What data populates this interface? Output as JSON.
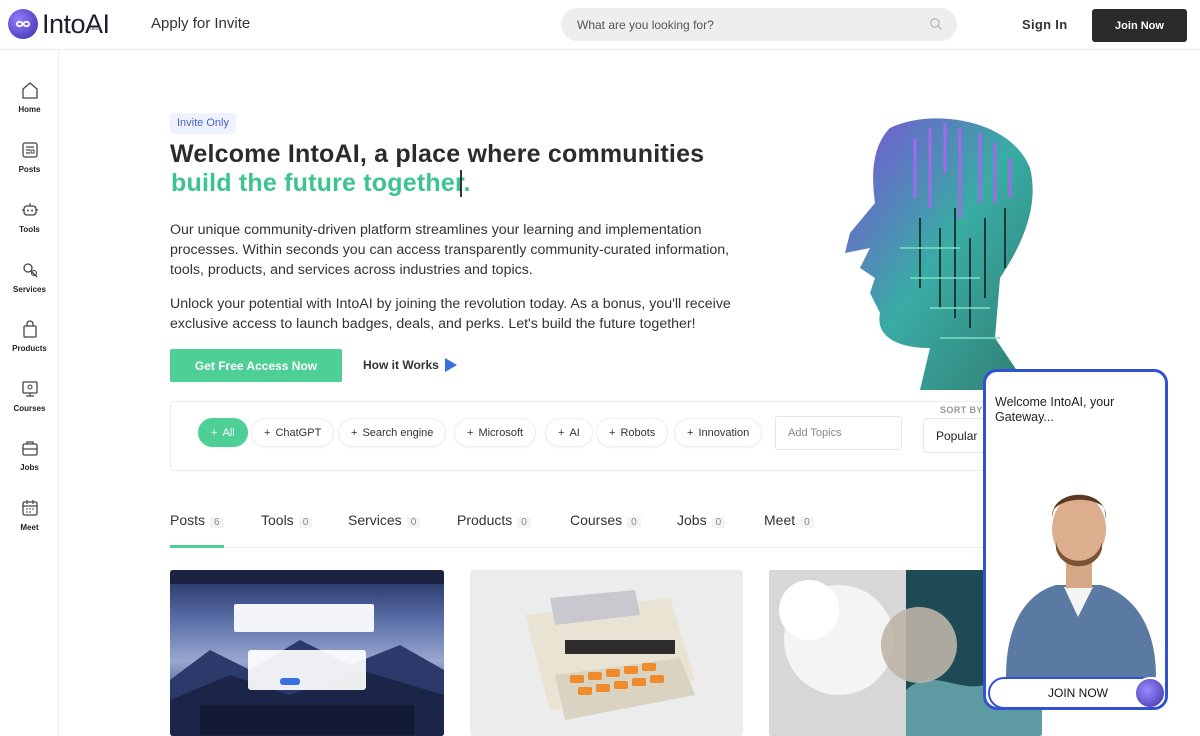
{
  "header": {
    "logo_text": "IntoAI",
    "logo_beta": "beta",
    "apply": "Apply for Invite",
    "search_placeholder": "What are you looking for?",
    "signin": "Sign In",
    "join": "Join Now"
  },
  "sidebar": {
    "items": [
      {
        "label": "Home",
        "icon": "home-icon"
      },
      {
        "label": "Posts",
        "icon": "posts-icon"
      },
      {
        "label": "Tools",
        "icon": "robot-icon"
      },
      {
        "label": "Services",
        "icon": "services-icon"
      },
      {
        "label": "Products",
        "icon": "bag-icon"
      },
      {
        "label": "Courses",
        "icon": "courses-icon"
      },
      {
        "label": "Jobs",
        "icon": "briefcase-icon"
      },
      {
        "label": "Meet",
        "icon": "calendar-icon"
      }
    ]
  },
  "hero": {
    "badge": "Invite Only",
    "title_line1": "Welcome IntoAI, a place where communities",
    "title_line2": "build the future together.",
    "paragraph1": "Our unique community-driven platform streamlines your learning and implementation processes. Within seconds you can access transparently community-curated information, tools, products, and services across industries and topics.",
    "paragraph2": "Unlock your potential with IntoAI by joining the revolution today. As a bonus, you'll receive exclusive access to launch badges, deals, and perks. Let's build the future together!",
    "cta": "Get Free Access Now",
    "how_it_works": "How it Works"
  },
  "filters": {
    "chips": [
      "All",
      "ChatGPT",
      "Search engine",
      "Microsoft",
      "AI",
      "Robots",
      "Innovation"
    ],
    "add_topics_placeholder": "Add Topics",
    "sort_label": "SORT BY",
    "sort_value": "Popular"
  },
  "tabs": [
    {
      "label": "Posts",
      "count": "6"
    },
    {
      "label": "Tools",
      "count": "0"
    },
    {
      "label": "Services",
      "count": "0"
    },
    {
      "label": "Products",
      "count": "0"
    },
    {
      "label": "Courses",
      "count": "0"
    },
    {
      "label": "Jobs",
      "count": "0"
    },
    {
      "label": "Meet",
      "count": "0"
    }
  ],
  "video_widget": {
    "title": "Welcome IntoAI, your Gateway...",
    "cta": "JOIN NOW"
  },
  "colors": {
    "accent_green": "#4ecf96",
    "brand_blue": "#3252d6",
    "dark_button": "#2a2a2a"
  }
}
